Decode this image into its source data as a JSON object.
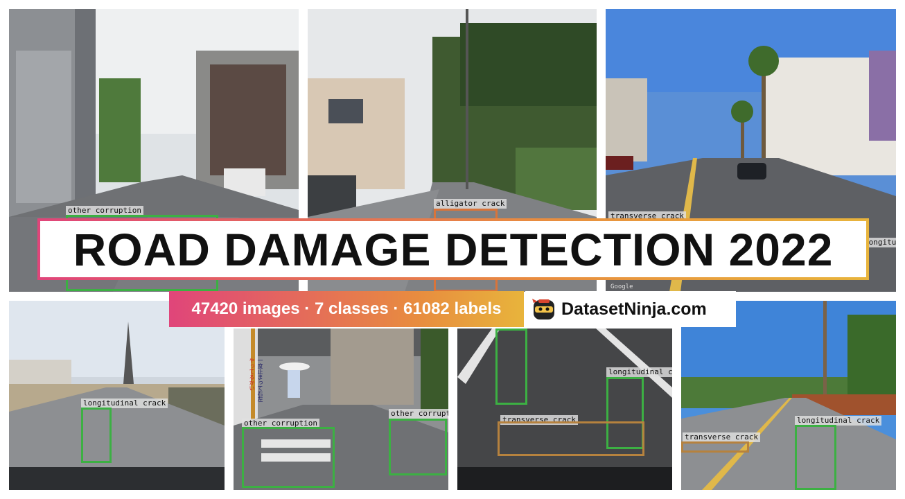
{
  "banner": {
    "title": "ROAD DAMAGE DETECTION 2022",
    "stats": "47420 images · 7 classes · 61082 labels",
    "brand": "DatasetNinja.com"
  },
  "icons": {
    "brand_logo": "ninja-logo-icon"
  },
  "colors": {
    "gradient_start": "#e0457a",
    "gradient_mid": "#e88c3f",
    "gradient_end": "#e8b43c",
    "box_green": "#3cb043",
    "box_orange": "#d9743a",
    "box_brown": "#b6823e"
  },
  "tiles": [
    {
      "labels": [
        "other corruption"
      ]
    },
    {
      "labels": [
        "alligator crack"
      ]
    },
    {
      "labels": [
        "transverse crack",
        "longitudinal crack"
      ],
      "watermark": "Google"
    },
    {
      "labels": [
        "longitudinal crack"
      ]
    },
    {
      "labels": [
        "other corruption",
        "other corruption"
      ],
      "signs": [
        "やってるかい",
        "一度止まって右左"
      ]
    },
    {
      "labels": [
        "longitudinal crack",
        "transverse crack"
      ]
    },
    {
      "labels": [
        "longitudinal crack",
        "transverse crack"
      ]
    }
  ]
}
